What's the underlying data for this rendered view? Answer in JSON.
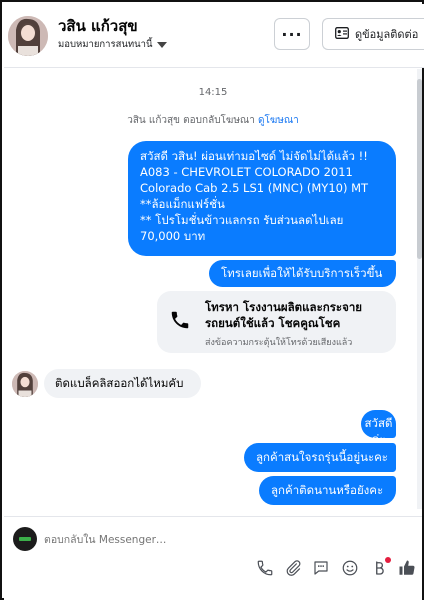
{
  "header": {
    "name": "วสิน แก้วสุข",
    "assign_label": "มอบหมายการสนทนานี้",
    "more_label": "···",
    "contact_info_label": "ดูข้อมูลติดต่อ"
  },
  "chat": {
    "timestamp": "14:15",
    "system_message": {
      "text": "วสิน แก้วสุข ตอบกลับโฆษณา",
      "link": "ดูโฆษณา"
    },
    "ad_message": {
      "lines": [
        "สวัสดี วสิน! ผ่อนเท่ามอไซด์ ไม่จัดไม่ได้แล้ว !!",
        "A083 - CHEVROLET COLORADO 2011",
        "Colorado Cab 2.5 LS1 (MNC) (MY10) MT",
        "**ล้อแม็กแฟร์ชั่น",
        "** โปรโมชั่นข้าวแลกรถ รับส่วนลดไปเลย",
        "70,000 บาท"
      ]
    },
    "cta_message": "โทรเลยเพื่อให้ได้รับบริการเร็วขึ้น",
    "call_card": {
      "title": "โทรหา โรงงานผลิตและกระจายรถยนต์ใช้แล้ว โชคคูณโชค",
      "subtitle": "ส่งข้อความกระตุ้นให้โทรด้วยเสียงแล้ว"
    },
    "incoming_message": "ติดแบล็คลิสออกได้ไหมคับ",
    "outgoing_messages": [
      "สวัสดีค่ะ",
      "ลูกค้าสนใจรถรุ่นนี้อยู่นะคะ",
      "ลูกค้าติดนานหรือยังคะ"
    ]
  },
  "composer": {
    "placeholder": "ตอบกลับใน Messenger…",
    "tools": [
      "phone-icon",
      "attachment-icon",
      "saved-reply-icon",
      "emoji-icon",
      "payment-icon",
      "like-icon"
    ]
  },
  "colors": {
    "accent": "#0a7cff",
    "incoming_bg": "#f0f2f5",
    "link": "#1877f2"
  }
}
